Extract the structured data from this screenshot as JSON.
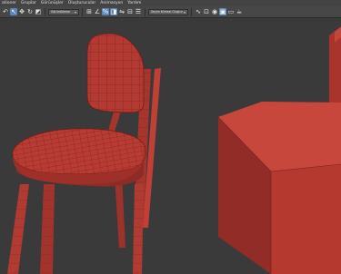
{
  "menubar": {
    "items": [
      "ationer",
      "Gruplar",
      "Görünüşler",
      "Oluşturucular",
      "Animasyon",
      "Yardım"
    ]
  },
  "toolbar": {
    "coordinate_dropdown": "Görüntüleme",
    "selection_set_dropdown": "Seçim Kümesi Oluştur",
    "icons": [
      "undo-icon",
      "select-icon",
      "move-icon",
      "rotate-icon",
      "scale-icon",
      "snap-icon",
      "angle-snap-icon",
      "percent-snap-icon",
      "mirror-icon",
      "align-icon",
      "layers-icon",
      "curve-editor-icon",
      "schematic-view-icon",
      "material-editor-icon",
      "render-setup-icon",
      "render-frame-icon",
      "render-icon"
    ]
  },
  "colors": {
    "menubar_bg": "#444444",
    "toolbar_bg": "#474747",
    "viewport_bg": "#3a3a3a",
    "model_red": "#b23a33",
    "wire_color": "#6e1c18",
    "active_tool": "#5b86b8"
  },
  "viewport": {
    "objects": [
      "chair",
      "box"
    ]
  }
}
